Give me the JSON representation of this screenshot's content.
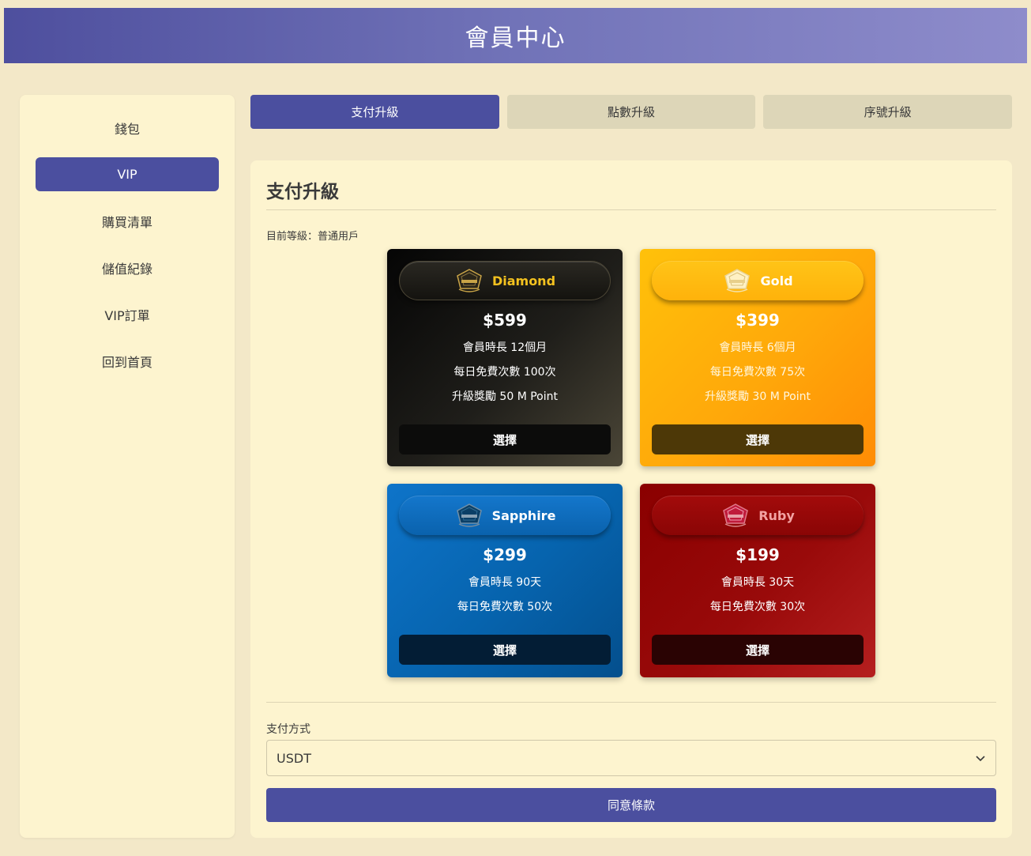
{
  "header": {
    "title": "會員中心"
  },
  "sidebar": {
    "items": [
      {
        "label": "錢包"
      },
      {
        "label": "VIP"
      },
      {
        "label": "購買清單"
      },
      {
        "label": "儲值紀錄"
      },
      {
        "label": "VIP訂單"
      },
      {
        "label": "回到首頁"
      }
    ],
    "active_index": 1
  },
  "tabs": [
    {
      "label": "支付升級"
    },
    {
      "label": "點數升級"
    },
    {
      "label": "序號升級"
    }
  ],
  "panel": {
    "title": "支付升級",
    "current_level": "目前等級：普通用戶"
  },
  "plans": [
    {
      "name": "Diamond",
      "price": "$599",
      "features": [
        "會員時長 12個月",
        "每日免費次數 100次",
        "升級獎勵 50 M Point"
      ],
      "button": "選擇",
      "color": "#f4c21f"
    },
    {
      "name": "Gold",
      "price": "$399",
      "features": [
        "會員時長 6個月",
        "每日免費次數 75次",
        "升級獎勵 30 M Point"
      ],
      "button": "選擇",
      "color": "#ffb20b"
    },
    {
      "name": "Sapphire",
      "price": "$299",
      "features": [
        "會員時長 90天",
        "每日免費次數 50次"
      ],
      "button": "選擇",
      "color": "#0a62ad"
    },
    {
      "name": "Ruby",
      "price": "$199",
      "features": [
        "會員時長 30天",
        "每日免費次數 30次"
      ],
      "button": "選擇",
      "color": "#8a0505"
    }
  ],
  "payment": {
    "label": "支付方式",
    "selected": "USDT"
  },
  "agree_button": "同意條款"
}
